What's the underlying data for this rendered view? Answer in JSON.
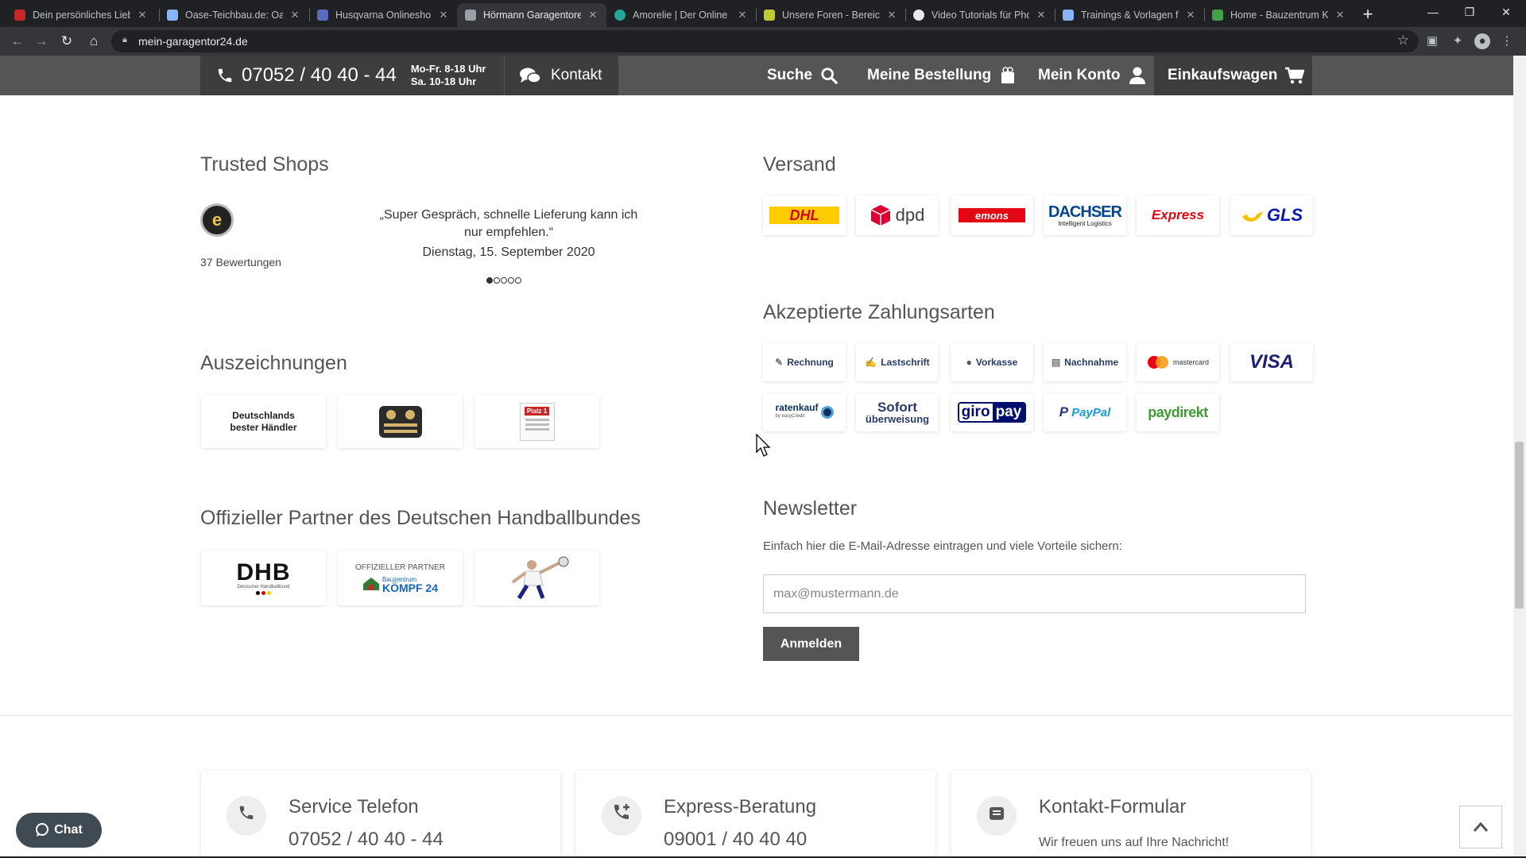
{
  "browser": {
    "tabs": [
      {
        "title": "Dein persönliches Lieb",
        "favicon_color": "#c62828",
        "active": false
      },
      {
        "title": "Oase-Teichbau.de: Oas",
        "favicon_color": "#8ab4f8",
        "active": false
      },
      {
        "title": "Husqvarna Onlineshop",
        "favicon_color": "#5c6bc0",
        "active": false
      },
      {
        "title": "Hörmann Garagentore",
        "favicon_color": "#9aa0a6",
        "active": true
      },
      {
        "title": "Amorelie | Der Online S",
        "favicon_color": "#26a69a",
        "active": false
      },
      {
        "title": "Unsere Foren - Bereich",
        "favicon_color": "#c0ca33",
        "active": false
      },
      {
        "title": "Video Tutorials für Pho",
        "favicon_color": "#e8eaed",
        "active": false
      },
      {
        "title": "Trainings & Vorlagen fü",
        "favicon_color": "#8ab4f8",
        "active": false
      },
      {
        "title": "Home - Bauzentrum Kö",
        "favicon_color": "#43a047",
        "active": false
      }
    ],
    "url": "mein-garagentor24.de"
  },
  "header": {
    "phone": "07052 / 40 40 - 44",
    "hours_1": "Mo-Fr. 8-18 Uhr",
    "hours_2": "Sa. 10-18 Uhr",
    "kontakt": "Kontakt",
    "suche": "Suche",
    "bestellung": "Meine Bestellung",
    "konto": "Mein Konto",
    "warenkorb": "Einkaufswagen"
  },
  "trusted_shops": {
    "heading": "Trusted Shops",
    "badge": "e",
    "reviews": "37 Bewertungen",
    "quote": "„Super Gespräch, schnelle Lieferung kann ich nur empfehlen.“",
    "date": "Dienstag, 15. September 2020",
    "slides": 5,
    "active_slide": 1
  },
  "awards": {
    "heading": "Auszeichnungen",
    "items": [
      "Deutschlands",
      "bester Händler",
      "Platz 1"
    ]
  },
  "partner": {
    "heading": "Offizieller Partner des Deutschen Handballbundes",
    "dhb": "DHB",
    "dhb_sub": "Deutscher Handballbund",
    "kompf_top": "OFFIZIELLER PARTNER",
    "kompf_mid": "Bauzentrum",
    "kompf_name": "KÖMPF 24"
  },
  "shipping": {
    "heading": "Versand",
    "carriers": [
      "DHL",
      "dpd",
      "emons",
      "DACHSER",
      "Intelligent Logistics",
      "Express",
      "GLS"
    ]
  },
  "payment": {
    "heading": "Akzeptierte Zahlungsarten",
    "methods": [
      "Rechnung",
      "Lastschrift",
      "Vorkasse",
      "Nachnahme",
      "mastercard",
      "VISA",
      "ratenkauf",
      "by easyCredit",
      "Sofort",
      "überweisung",
      "giro",
      "pay",
      "PayPal",
      "paydirekt"
    ]
  },
  "newsletter": {
    "heading": "Newsletter",
    "text": "Einfach hier die E-Mail-Adresse eintragen und viele Vorteile sichern:",
    "placeholder": "max@mustermann.de",
    "button": "Anmelden"
  },
  "contact_cards": [
    {
      "title": "Service Telefon",
      "value": "07052 / 40 40 - 44",
      "icon": "phone-icon"
    },
    {
      "title": "Express-Beratung",
      "value": "09001 / 40 40 40",
      "icon": "phone-plus-icon"
    },
    {
      "title": "Kontakt-Formular",
      "value": "Wir freuen uns auf Ihre Nachricht!",
      "icon": "contact-form-icon"
    }
  ],
  "chat": "Chat"
}
